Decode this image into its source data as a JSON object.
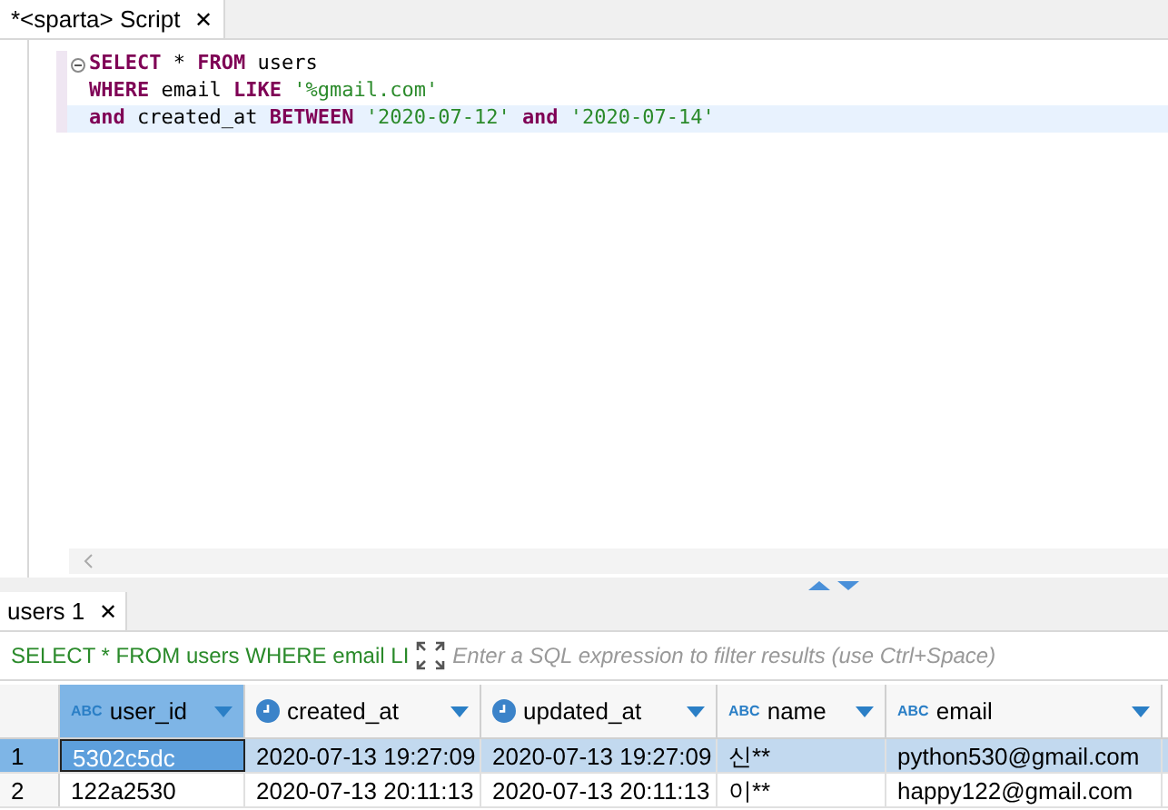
{
  "editor_tab": {
    "title": "*<sparta> Script",
    "close": "✕"
  },
  "editor": {
    "lines": [
      {
        "highlighted": false,
        "foldable": true,
        "tokens": [
          {
            "kind": "keyword",
            "text": "SELECT"
          },
          {
            "kind": "plain",
            "text": " * "
          },
          {
            "kind": "keyword",
            "text": "FROM"
          },
          {
            "kind": "plain",
            "text": " users"
          }
        ]
      },
      {
        "highlighted": false,
        "foldable": false,
        "tokens": [
          {
            "kind": "keyword",
            "text": "WHERE"
          },
          {
            "kind": "plain",
            "text": " email "
          },
          {
            "kind": "keyword",
            "text": "LIKE"
          },
          {
            "kind": "string",
            "text": " '%gmail.com'"
          }
        ]
      },
      {
        "highlighted": true,
        "foldable": false,
        "tokens": [
          {
            "kind": "keyword",
            "text": "and"
          },
          {
            "kind": "plain",
            "text": " created_at "
          },
          {
            "kind": "keyword",
            "text": "BETWEEN"
          },
          {
            "kind": "string",
            "text": " '2020-07-12' "
          },
          {
            "kind": "keyword",
            "text": "and"
          },
          {
            "kind": "string",
            "text": " '2020-07-14'"
          }
        ]
      }
    ]
  },
  "results_tab": {
    "title": "users 1",
    "close": "✕"
  },
  "filter": {
    "query": "SELECT * FROM users WHERE email LI",
    "placeholder": "Enter a SQL expression to filter results (use Ctrl+Space)"
  },
  "table": {
    "columns": [
      {
        "label": "user_id",
        "kind": "text",
        "type_label": "ABC",
        "selected": true
      },
      {
        "label": "created_at",
        "kind": "datetime",
        "selected": false
      },
      {
        "label": "updated_at",
        "kind": "datetime",
        "selected": false
      },
      {
        "label": "name",
        "kind": "text",
        "type_label": "ABC",
        "selected": false
      },
      {
        "label": "email",
        "kind": "text",
        "type_label": "ABC",
        "selected": false
      }
    ],
    "rows": [
      {
        "number": "1",
        "selected": true,
        "cells": [
          {
            "text": "5302c5dc",
            "focused": true
          },
          {
            "text": "2020-07-13 19:27:09",
            "focused": false
          },
          {
            "text": "2020-07-13 19:27:09",
            "focused": false
          },
          {
            "text": "신**",
            "focused": false
          },
          {
            "text": "python530@gmail.com",
            "focused": false
          }
        ]
      },
      {
        "number": "2",
        "selected": false,
        "cells": [
          {
            "text": "122a2530",
            "focused": false
          },
          {
            "text": "2020-07-13 20:11:13",
            "focused": false
          },
          {
            "text": "2020-07-13 20:11:13",
            "focused": false
          },
          {
            "text": "이**",
            "focused": false
          },
          {
            "text": "happy122@gmail.com",
            "focused": false
          }
        ]
      }
    ]
  }
}
